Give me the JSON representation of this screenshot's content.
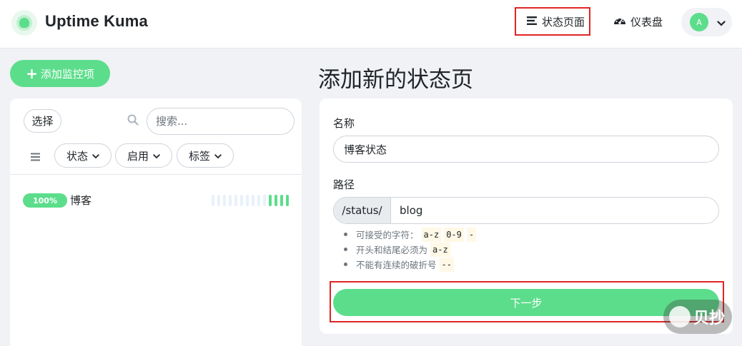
{
  "header": {
    "brand": "Uptime Kuma",
    "nav_status_label": "状态页面",
    "nav_dashboard_label": "仪表盘",
    "avatar_initial": "A"
  },
  "sidebar": {
    "add_button_label": "添加监控项",
    "select_label": "选择",
    "search_placeholder": "搜索...",
    "filters": [
      "状态",
      "启用",
      "标签"
    ],
    "monitors": [
      {
        "uptime": "100%",
        "name": "博客"
      }
    ]
  },
  "main": {
    "title": "添加新的状态页",
    "name_label": "名称",
    "name_value": "博客状态",
    "path_label": "路径",
    "path_prefix": "/status/",
    "path_value": "blog",
    "hints": {
      "h1_text": "可接受的字符：",
      "h1_codes": [
        "a-z",
        "0-9",
        "-"
      ],
      "h2_text": "开头和结尾必须为",
      "h2_code": "a-z",
      "h3_text": "不能有连续的破折号",
      "h3_code": "--"
    },
    "next_button_label": "下一步"
  },
  "watermark": {
    "text": "贝抄"
  },
  "colors": {
    "accent": "#5cdd8b",
    "highlight_border": "#e02424",
    "page_bg": "#f0f2f5"
  }
}
